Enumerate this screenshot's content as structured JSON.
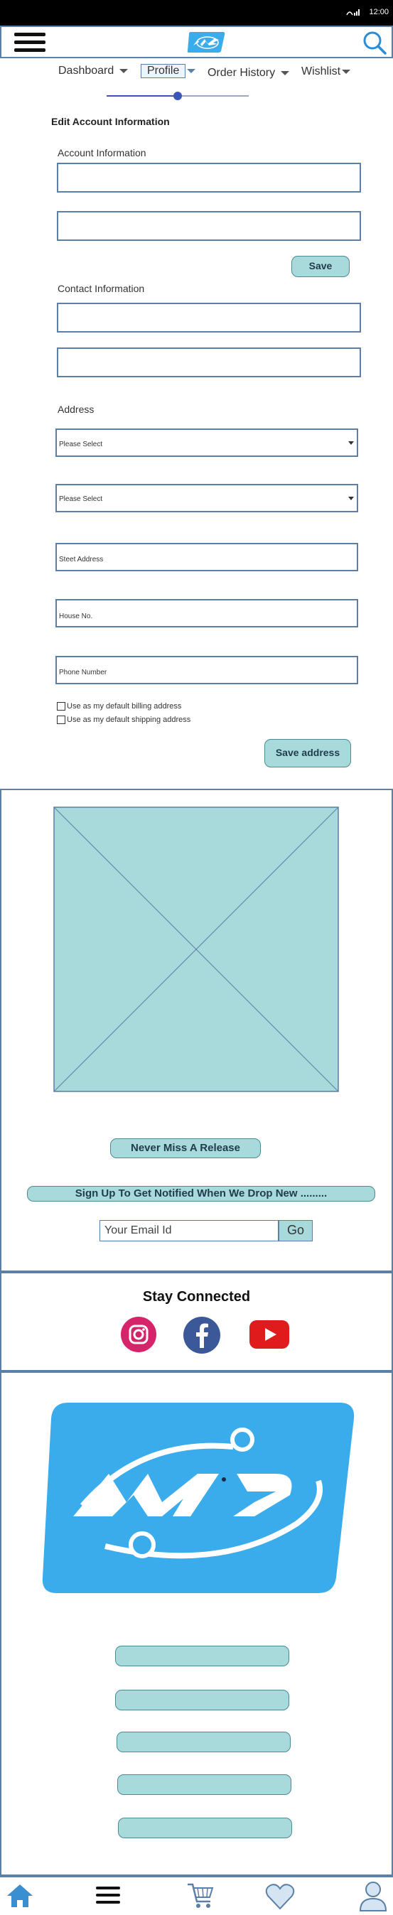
{
  "status": {
    "time": "12:00"
  },
  "nav": {
    "dashboard": "Dashboard",
    "profile": "Profile",
    "order_history": "Order History",
    "wishlist": "Wishlist"
  },
  "form": {
    "title": "Edit Account Information",
    "account_label": "Account Information",
    "save_label": "Save",
    "contact_label": "Contact Information",
    "address_label": "Address",
    "select1": "Please Select",
    "select2": "Please Select",
    "street_placeholder": "Steet Address",
    "house_placeholder": "House No.",
    "phone_placeholder": "Phone Number",
    "billing_checkbox": "Use as my default billing address",
    "shipping_checkbox": "Use as my default shipping address",
    "save_address_label": "Save address"
  },
  "promo": {
    "never_miss": "Never Miss A Release",
    "signup": "Sign Up To Get Notified When We Drop New .........",
    "email_placeholder": "Your Email Id",
    "go_label": "Go"
  },
  "social": {
    "title": "Stay Connected"
  },
  "colors": {
    "accent": "#3aabeb",
    "pill": "#a9dadb",
    "border": "#5b7fa6"
  },
  "icons": {
    "menu": "hamburger-icon",
    "search": "search-icon",
    "instagram": "instagram-icon",
    "facebook": "facebook-icon",
    "youtube": "youtube-icon",
    "home": "home-icon",
    "cart": "cart-icon",
    "wishlist": "heart-icon",
    "profile": "user-icon"
  }
}
